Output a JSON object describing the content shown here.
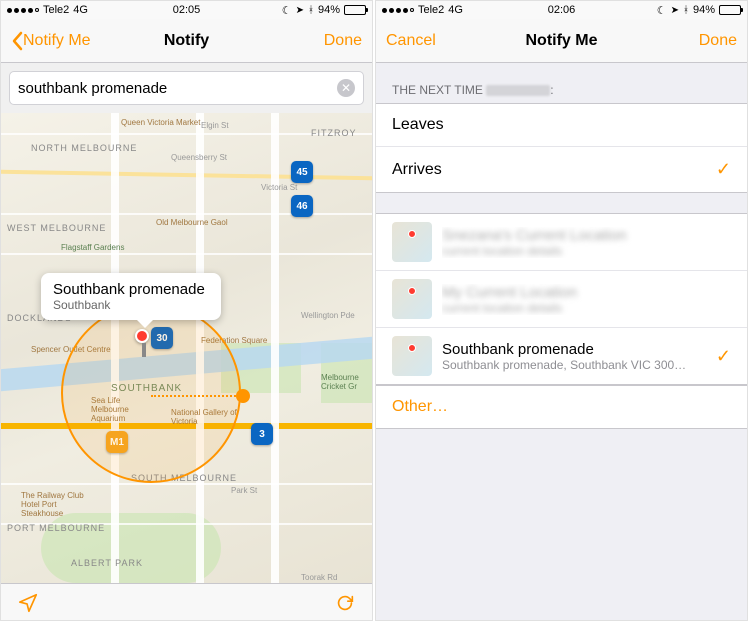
{
  "left": {
    "status": {
      "carrier": "Tele2",
      "network": "4G",
      "time": "02:05",
      "battery_pct": "94%"
    },
    "nav": {
      "back_label": "Notify Me",
      "title": "Notify",
      "done": "Done"
    },
    "search": {
      "value": "southbank promenade"
    },
    "callout": {
      "title": "Southbank promenade",
      "subtitle": "Southbank"
    },
    "map_labels": {
      "north_melbourne": "NORTH MELBOURNE",
      "west_melbourne": "WEST MELBOURNE",
      "fitzroy": "FITZROY",
      "docklands": "DOCKLANDS",
      "southbank": "SOUTHBANK",
      "south_melbourne": "SOUTH MELBOURNE",
      "port_melbourne": "PORT MELBOURNE",
      "albert_park": "ALBERT PARK",
      "queen_victoria": "Queen Victoria Market",
      "old_gaol": "Old Melbourne Gaol",
      "queensberry": "Queensberry St",
      "elgin": "Elgin St",
      "victoria": "Victoria St",
      "flagstaff": "Flagstaff Gardens",
      "wellington": "Wellington Pde",
      "spencer": "Spencer Outlet Centre",
      "federation": "Federation Square",
      "sealife": "Sea Life Melbourne Aquarium",
      "ngv": "National Gallery of Victoria",
      "cricket": "Melbourne Cricket Gr",
      "railway": "The Railway Club Hotel Port Steakhouse",
      "park_st": "Park St",
      "toorak": "Toorak Rd"
    },
    "route_badges": {
      "r45": "45",
      "r46": "46",
      "r30": "30",
      "m1": "M1",
      "r3": "3"
    }
  },
  "right": {
    "status": {
      "carrier": "Tele2",
      "network": "4G",
      "time": "02:06",
      "battery_pct": "94%"
    },
    "nav": {
      "cancel": "Cancel",
      "title": "Notify Me",
      "done": "Done"
    },
    "section_header_prefix": "THE NEXT TIME",
    "section_header_suffix": ":",
    "options": {
      "leaves": "Leaves",
      "arrives": "Arrives"
    },
    "locations": [
      {
        "title": "Snezana's Current Location",
        "subtitle": "current location details"
      },
      {
        "title": "My Current Location",
        "subtitle": "current location details"
      },
      {
        "title": "Southbank promenade",
        "subtitle": "Southbank promenade, Southbank VIC 300…"
      }
    ],
    "other": "Other…"
  }
}
